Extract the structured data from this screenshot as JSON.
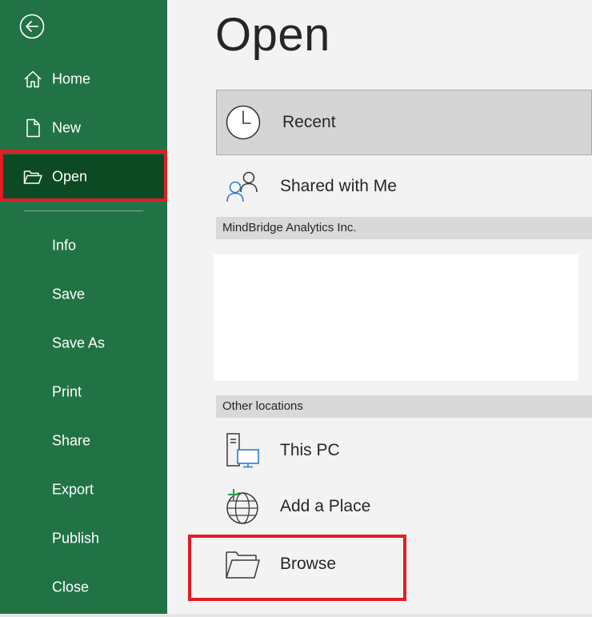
{
  "sidebar": {
    "back_icon": "arrow-left-circle-icon",
    "items": [
      {
        "label": "Home",
        "icon": "home-icon"
      },
      {
        "label": "New",
        "icon": "new-document-icon"
      },
      {
        "label": "Open",
        "icon": "open-folder-icon",
        "active": true
      },
      {
        "label": "Info"
      },
      {
        "label": "Save"
      },
      {
        "label": "Save As"
      },
      {
        "label": "Print"
      },
      {
        "label": "Share"
      },
      {
        "label": "Export"
      },
      {
        "label": "Publish"
      },
      {
        "label": "Close"
      }
    ]
  },
  "main": {
    "title": "Open",
    "locations": [
      {
        "label": "Recent",
        "icon": "clock-icon",
        "selected": true
      },
      {
        "label": "Shared with Me",
        "icon": "people-icon"
      }
    ],
    "org_section": {
      "header": "MindBridge Analytics Inc."
    },
    "other_section": {
      "header": "Other locations",
      "items": [
        {
          "label": "This PC",
          "icon": "computer-icon"
        },
        {
          "label": "Add a Place",
          "icon": "globe-add-icon"
        },
        {
          "label": "Browse",
          "icon": "folder-icon"
        }
      ]
    }
  },
  "colors": {
    "sidebar_bg": "#217346",
    "sidebar_active": "#0c4a24",
    "highlight": "#e01e25",
    "main_bg": "#f3f3f3",
    "selected_bg": "#d5d5d5",
    "section_bg": "#d9d9d9"
  }
}
